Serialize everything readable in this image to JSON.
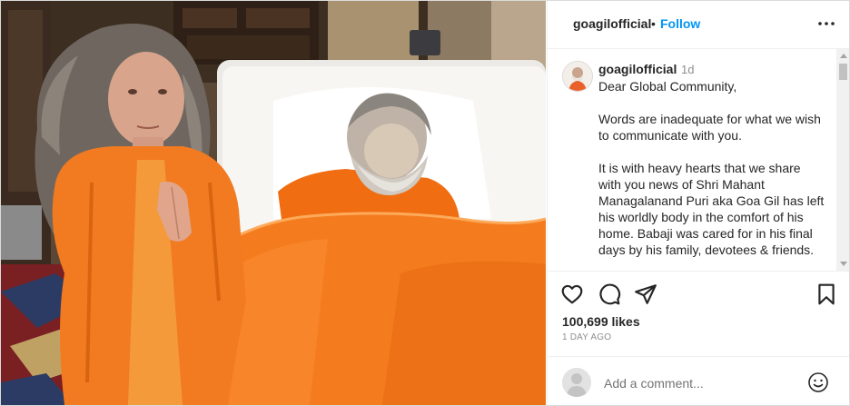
{
  "post": {
    "username": "goagilofficial",
    "separator": "•",
    "follow_label": "Follow"
  },
  "caption": {
    "username": "goagilofficial",
    "time": "1d",
    "paragraphs": [
      "Dear Global Community,",
      "Words are inadequate for what we wish to communicate with you.",
      "It is with heavy hearts that we share with you news of Shri Mahant Managalanand Puri aka Goa Gil has left his worldly body in the comfort of his home. Babaji was cared for in his final days by his family, devotees & friends."
    ]
  },
  "actions": {
    "like_icon": "heart-icon",
    "comment_icon": "comment-icon",
    "share_icon": "send-icon",
    "save_icon": "bookmark-icon"
  },
  "likes": "100,699 likes",
  "time_ago": "1 DAY AGO",
  "comment_box": {
    "placeholder": "Add a comment...",
    "emoji_icon": "emoji-icon"
  },
  "colors": {
    "accent": "#0095f6",
    "robe_orange": "#f47a1f",
    "text": "#262626",
    "muted": "#8e8e8e"
  }
}
